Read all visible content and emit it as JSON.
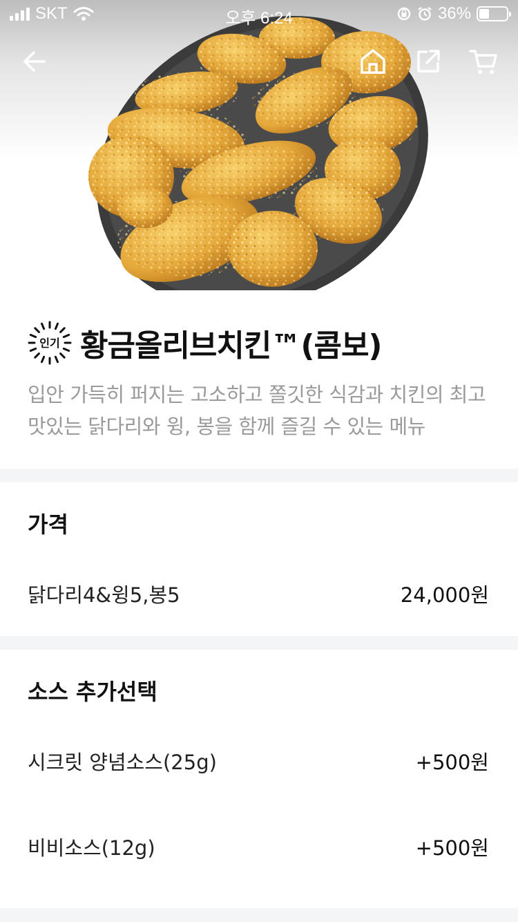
{
  "status_bar": {
    "carrier": "SKT",
    "time": "오후 6:24",
    "battery": "36%",
    "battery_level": 0.36
  },
  "nav": {
    "icons": [
      "back-arrow-icon",
      "home-icon",
      "share-icon",
      "cart-icon"
    ]
  },
  "product": {
    "badge": "인기",
    "name": "황금올리브치킨™(콤보)",
    "description": "입안 가득히 퍼지는 고소하고 쫄깃한 식감과 치킨의 최고 맛있는 닭다리와 윙, 봉을 함께 즐길 수 있는 메뉴"
  },
  "price_section": {
    "title": "가격",
    "items": [
      {
        "label": "닭다리4&윙5,봉5",
        "price": "24,000원"
      }
    ]
  },
  "sauce_section": {
    "title": "소스 추가선택",
    "items": [
      {
        "label": "시크릿 양념소스(25g)",
        "price": "+500원"
      },
      {
        "label": "비비소스(12g)",
        "price": "+500원"
      }
    ]
  }
}
